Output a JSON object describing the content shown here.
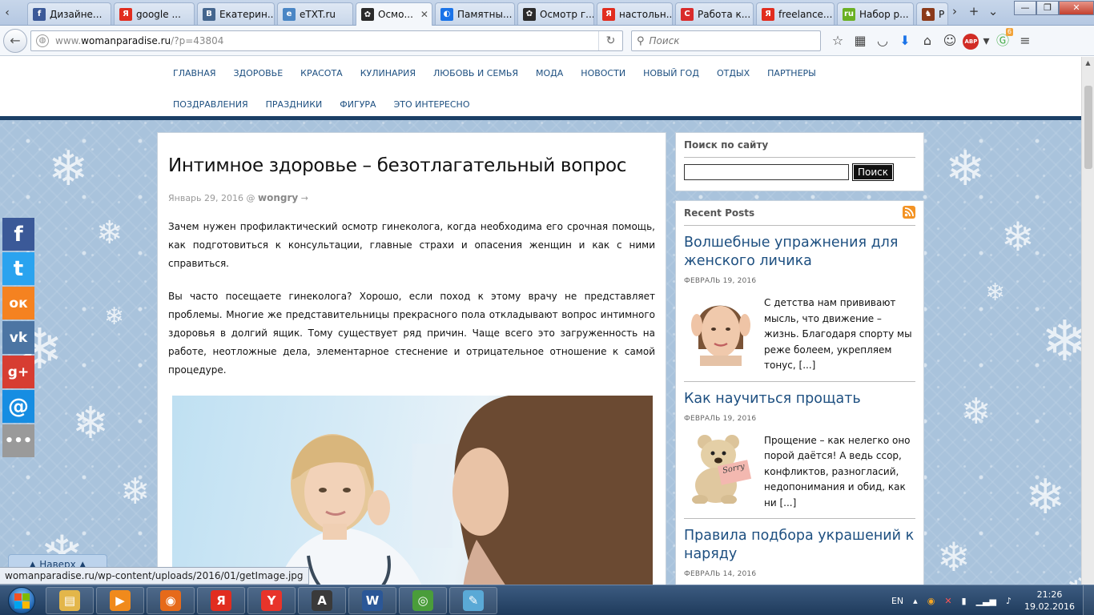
{
  "browser": {
    "tabs": [
      {
        "title": "Дизайне...",
        "color": "#3b5998",
        "glyph": "f"
      },
      {
        "title": "google ...",
        "color": "#e12d1f",
        "glyph": "Я"
      },
      {
        "title": "Екатерин...",
        "color": "#45668e",
        "glyph": "В"
      },
      {
        "title": "eTXT.ru",
        "color": "#4a86c5",
        "glyph": "e"
      },
      {
        "title": "Осмо...",
        "color": "#2b2b2b",
        "glyph": "✿",
        "active": true
      },
      {
        "title": "Памятны...",
        "color": "#1a73e8",
        "glyph": "◐"
      },
      {
        "title": "Осмотр г...",
        "color": "#2b2b2b",
        "glyph": "✿"
      },
      {
        "title": "настольн...",
        "color": "#e12d1f",
        "glyph": "Я"
      },
      {
        "title": "Работа к...",
        "color": "#d92b2b",
        "glyph": "С"
      },
      {
        "title": "freelance...",
        "color": "#e12d1f",
        "glyph": "Я"
      },
      {
        "title": "Набор р...",
        "color": "#6ab023",
        "glyph": "ru"
      },
      {
        "title": "Р",
        "color": "#8b3a1a",
        "glyph": "♞"
      }
    ],
    "url": {
      "prefix": "www.",
      "domain": "womanparadise.ru",
      "path": "/?p=43804"
    },
    "search_placeholder": "Поиск",
    "badge_count": "6",
    "status_url": "womanparadise.ru/wp-content/uploads/2016/01/getImage.jpg"
  },
  "site": {
    "menu": [
      "ГЛАВНАЯ",
      "ЗДОРОВЬЕ",
      "КРАСОТА",
      "КУЛИНАРИЯ",
      "ЛЮБОВЬ И СЕМЬЯ",
      "МОДА",
      "НОВОСТИ",
      "НОВЫЙ ГОД",
      "ОТДЫХ",
      "ПАРТНЕРЫ",
      "ПОЗДРАВЛЕНИЯ",
      "ПРАЗДНИКИ",
      "ФИГУРА",
      "ЭТО ИНТЕРЕСНО"
    ],
    "social": [
      {
        "name": "facebook",
        "glyph": "f",
        "color": "#3b5998"
      },
      {
        "name": "twitter",
        "glyph": "t",
        "color": "#2aa3ef"
      },
      {
        "name": "odnoklassniki",
        "glyph": "ок",
        "color": "#f58220"
      },
      {
        "name": "vkontakte",
        "glyph": "vk",
        "color": "#4c75a3"
      },
      {
        "name": "google-plus",
        "glyph": "g+",
        "color": "#d73d32"
      },
      {
        "name": "mail",
        "glyph": "@",
        "color": "#168de2"
      },
      {
        "name": "more",
        "glyph": "•••",
        "color": "#9a9a9a"
      }
    ],
    "scroll_top_label": "▲ Наверх ▲",
    "post": {
      "title": "Интимное здоровье – безотлагательный вопрос",
      "date": "Январь 29, 2016 @",
      "author": "wongry",
      "author_arrow": "→",
      "paragraphs": [
        "Зачем нужен профилактический осмотр гинеколога, когда необходима его срочная помощь, как подготовиться к консультации, главные страхи и опасения женщин и как с ними справиться.",
        "Вы часто посещаете гинеколога? Хорошо, если поход к этому врачу не представляет проблемы. Многие же представительницы прекрасного пола откладывают вопрос интимного здоровья в долгий ящик. Тому существует ряд причин. Чаще всего это загруженность на работе, неотложные дела, элементарное стеснение и отрицательное отношение к самой процедуре."
      ]
    },
    "sidebar": {
      "search_title": "Поиск по сайту",
      "search_button": "Поиск",
      "recent_title": "Recent Posts",
      "recent": [
        {
          "title": "Волшебные упражнения для женского личика",
          "date": "ФЕВРАЛЬ 19, 2016",
          "excerpt": "С детства нам прививают мысль, что движение – жизнь. Благодаря спорту мы реже болеем, укрепляем тонус, [...]"
        },
        {
          "title": "Как научиться прощать",
          "date": "ФЕВРАЛЬ 19, 2016",
          "excerpt": "Прощение – как нелегко оно порой даётся! А ведь ссор, конфликтов, разногласий, недопонимания и обид, как ни [...]",
          "thumb_text": "Sorry"
        },
        {
          "title": "Правила подбора украшений к наряду",
          "date": "ФЕВРАЛЬ 14, 2016"
        }
      ]
    }
  },
  "taskbar": {
    "apps": [
      {
        "name": "explorer",
        "glyph": "▤",
        "color": "#e3b64a"
      },
      {
        "name": "media-player",
        "glyph": "▶",
        "color": "#f08a1c"
      },
      {
        "name": "firefox",
        "glyph": "◉",
        "color": "#e66a1a"
      },
      {
        "name": "yandex",
        "glyph": "Я",
        "color": "#e12d1f"
      },
      {
        "name": "yandex-browser",
        "glyph": "Y",
        "color": "#e8342a"
      },
      {
        "name": "fonts",
        "glyph": "A",
        "color": "#3a3a3a"
      },
      {
        "name": "word",
        "glyph": "W",
        "color": "#2b5797"
      },
      {
        "name": "chrome",
        "glyph": "◎",
        "color": "#4a9d3a"
      },
      {
        "name": "notepad",
        "glyph": "✎",
        "color": "#5aa9d6"
      }
    ],
    "lang": "EN",
    "time": "21:26",
    "date": "19.02.2016"
  }
}
